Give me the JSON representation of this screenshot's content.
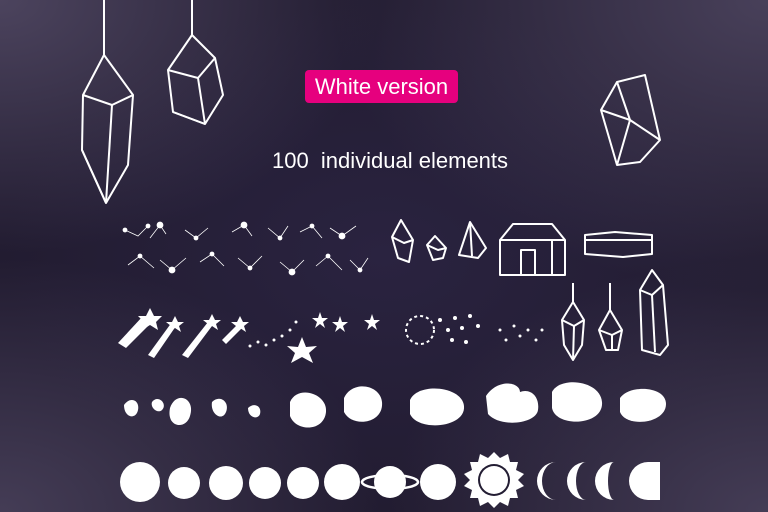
{
  "badge": {
    "label": "White version",
    "color": "#e6007e"
  },
  "subtitle": {
    "count": "100",
    "text": "individual elements"
  },
  "colors": {
    "background": "#231d33",
    "elements": "#ffffff"
  },
  "icons": [
    "hanging-crystal-icon",
    "crystal-icon",
    "constellation-icon",
    "house-wireframe-icon",
    "box-wireframe-icon",
    "shooting-star-icon",
    "star-icon",
    "stardust-icon",
    "blob-icon",
    "planet-icon",
    "ringed-planet-icon",
    "sun-icon",
    "moon-phase-icon"
  ]
}
